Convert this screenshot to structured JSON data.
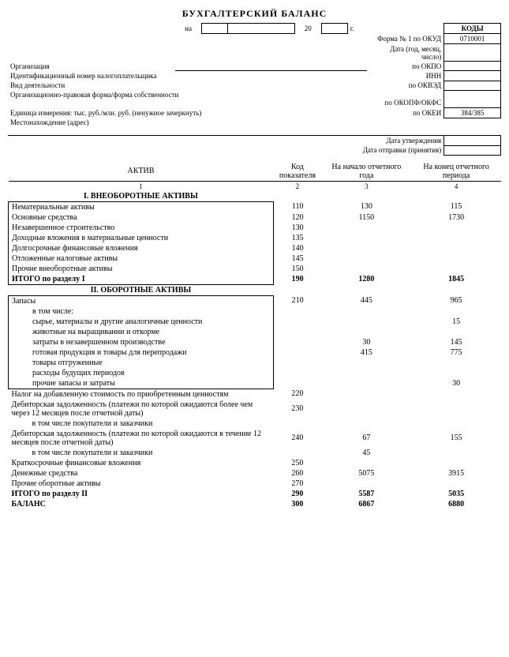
{
  "title": "БУХГАЛТЕРСКИЙ БАЛАНС",
  "header": {
    "date_label_prefix": "на",
    "date_day": "",
    "date_month": "",
    "date_year": "20",
    "unit_g": "г.",
    "codes_header": "КОДЫ",
    "okud_label": "Форма № 1 по ОКУД",
    "okud_code": "0710001",
    "date_code_label": "Дата (год, месяц, число)",
    "org_label": "Организация",
    "okpo_label": "по ОКПО",
    "inn_label": "Идентификационный номер налогоплательщика",
    "inn_right": "ИНН",
    "activity_label": "Вид деятельности",
    "okved_label": "по ОКВЭД",
    "form_label": "Организационно-правовая форма/форма собственности",
    "okopf_label": "по ОКОПФ/ОКФС",
    "okopf_code": "",
    "unit_label": "Единица измерения: тыс. руб./млн. руб. (ненужное зачеркнуть)",
    "okei_label": "по ОКЕИ",
    "okei_code": "384/385",
    "address_label": "Местонахождение (адрес)",
    "approval_label": "Дата утверждения",
    "sent_label": "Дата отправки (принятия)"
  },
  "columns": {
    "c1": "АКТИВ",
    "c2": "Код показателя",
    "c3": "На начало отчетного года",
    "c4": "На конец отчетного периода"
  },
  "numrow": {
    "c1": "1",
    "c2": "2",
    "c3": "3",
    "c4": "4"
  },
  "section1": {
    "heading": "I. ВНЕОБОРОТНЫЕ АКТИВЫ",
    "rows": [
      {
        "name": "Нематериальные активы",
        "code": "110",
        "v1": "130",
        "v2": "115"
      },
      {
        "name": "Основные средства",
        "code": "120",
        "v1": "1150",
        "v2": "1730"
      },
      {
        "name": "Незавершенное строительство",
        "code": "130",
        "v1": "",
        "v2": ""
      },
      {
        "name": "Доходные вложения в материальные ценности",
        "code": "135",
        "v1": "",
        "v2": ""
      },
      {
        "name": "Долгосрочные финансовые вложения",
        "code": "140",
        "v1": "",
        "v2": ""
      },
      {
        "name": "Отложенные налоговые активы",
        "code": "145",
        "v1": "",
        "v2": ""
      },
      {
        "name": "Прочие внеоборотные активы",
        "code": "150",
        "v1": "",
        "v2": ""
      }
    ],
    "total": {
      "name": "ИТОГО по разделу I",
      "code": "190",
      "v1": "1280",
      "v2": "1845"
    }
  },
  "section2": {
    "heading": "II. ОБОРОТНЫЕ АКТИВЫ",
    "zapasy": {
      "name": "Запасы",
      "code": "210",
      "v1": "445",
      "v2": "965"
    },
    "vtch": "в том числе:",
    "subrows": [
      {
        "name": "сырье, материалы и другие аналогичные ценности",
        "v1": "",
        "v2": "15"
      },
      {
        "name": "животные на выращивании и откорме",
        "v1": "",
        "v2": ""
      },
      {
        "name": "затраты в незавершенном производстве",
        "v1": "30",
        "v2": "145"
      },
      {
        "name": "готовая продукция и товары для перепродажи",
        "v1": "415",
        "v2": "775"
      },
      {
        "name": "товары отгруженные",
        "v1": "",
        "v2": ""
      },
      {
        "name": "расходы будущих периодов",
        "v1": "",
        "v2": ""
      },
      {
        "name": "прочие запасы и затраты",
        "v1": "",
        "v2": "30"
      }
    ],
    "rows": [
      {
        "name": "Налог на добавленную стоимость по приобретенным ценностям",
        "code": "220",
        "v1": "",
        "v2": ""
      },
      {
        "name": "Дебиторская задолженность (платежи по которой ожидаются более чем через 12 месяцев после отчетной даты)",
        "code": "230",
        "v1": "",
        "v2": ""
      },
      {
        "name": "в том числе покупатели и заказчики",
        "code": "",
        "v1": "",
        "v2": "",
        "sub": true
      },
      {
        "name": "Дебиторская задолженность (платежи по которой ожидаются в течение 12 месяцев после отчетной даты)",
        "code": "240",
        "v1": "67",
        "v2": "155"
      },
      {
        "name": "в том числе покупатели и заказчики",
        "code": "",
        "v1": "45",
        "v2": "",
        "sub": true
      },
      {
        "name": "Краткосрочные финансовые вложения",
        "code": "250",
        "v1": "",
        "v2": ""
      },
      {
        "name": "Денежные средства",
        "code": "260",
        "v1": "5075",
        "v2": "3915"
      },
      {
        "name": "Прочие оборотные активы",
        "code": "270",
        "v1": "",
        "v2": ""
      }
    ],
    "total": {
      "name": "ИТОГО по разделу II",
      "code": "290",
      "v1": "5587",
      "v2": "5035"
    },
    "balance": {
      "name": "БАЛАНС",
      "code": "300",
      "v1": "6867",
      "v2": "6880"
    }
  }
}
